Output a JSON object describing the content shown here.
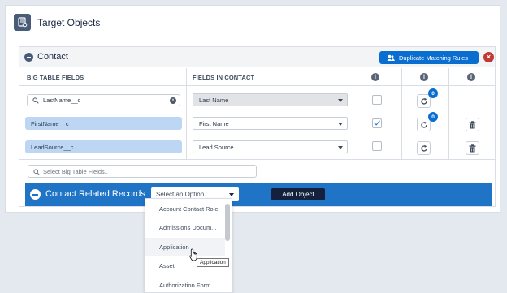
{
  "header": {
    "title": "Target Objects",
    "icon": "object-settings-icon"
  },
  "panel": {
    "title": "Contact",
    "duplicate_button": "Duplicate Matching Rules",
    "close_icon": "close-icon"
  },
  "columns": {
    "big_table": "BIG TABLE FIELDS",
    "fields_in": "FIELDS IN CONTACT"
  },
  "rows": [
    {
      "big_field": "LastName__c",
      "contact_field": "Last Name",
      "checked": false,
      "badge": "0",
      "deletable": false
    },
    {
      "big_field": "FirstName__c",
      "contact_field": "First Name",
      "checked": true,
      "badge": "0",
      "deletable": true
    },
    {
      "big_field": "LeadSource__c",
      "contact_field": "Lead Source",
      "checked": false,
      "badge": "",
      "deletable": true
    }
  ],
  "search": {
    "placeholder": "Select Big Table Fields.."
  },
  "related": {
    "title": "Contact Related Records",
    "select_value": "Select an Option",
    "add_button": "Add Object"
  },
  "dropdown": {
    "options": [
      "Account Contact Role",
      "Admissions Docum...",
      "Application",
      "Asset",
      "Authorization Form ..."
    ],
    "hovered": "Application",
    "tooltip": "Application"
  },
  "colors": {
    "accent": "#0a6ed1",
    "bar": "#1f74c6",
    "field_highlight": "#bcd6f3",
    "danger": "#c23934"
  }
}
